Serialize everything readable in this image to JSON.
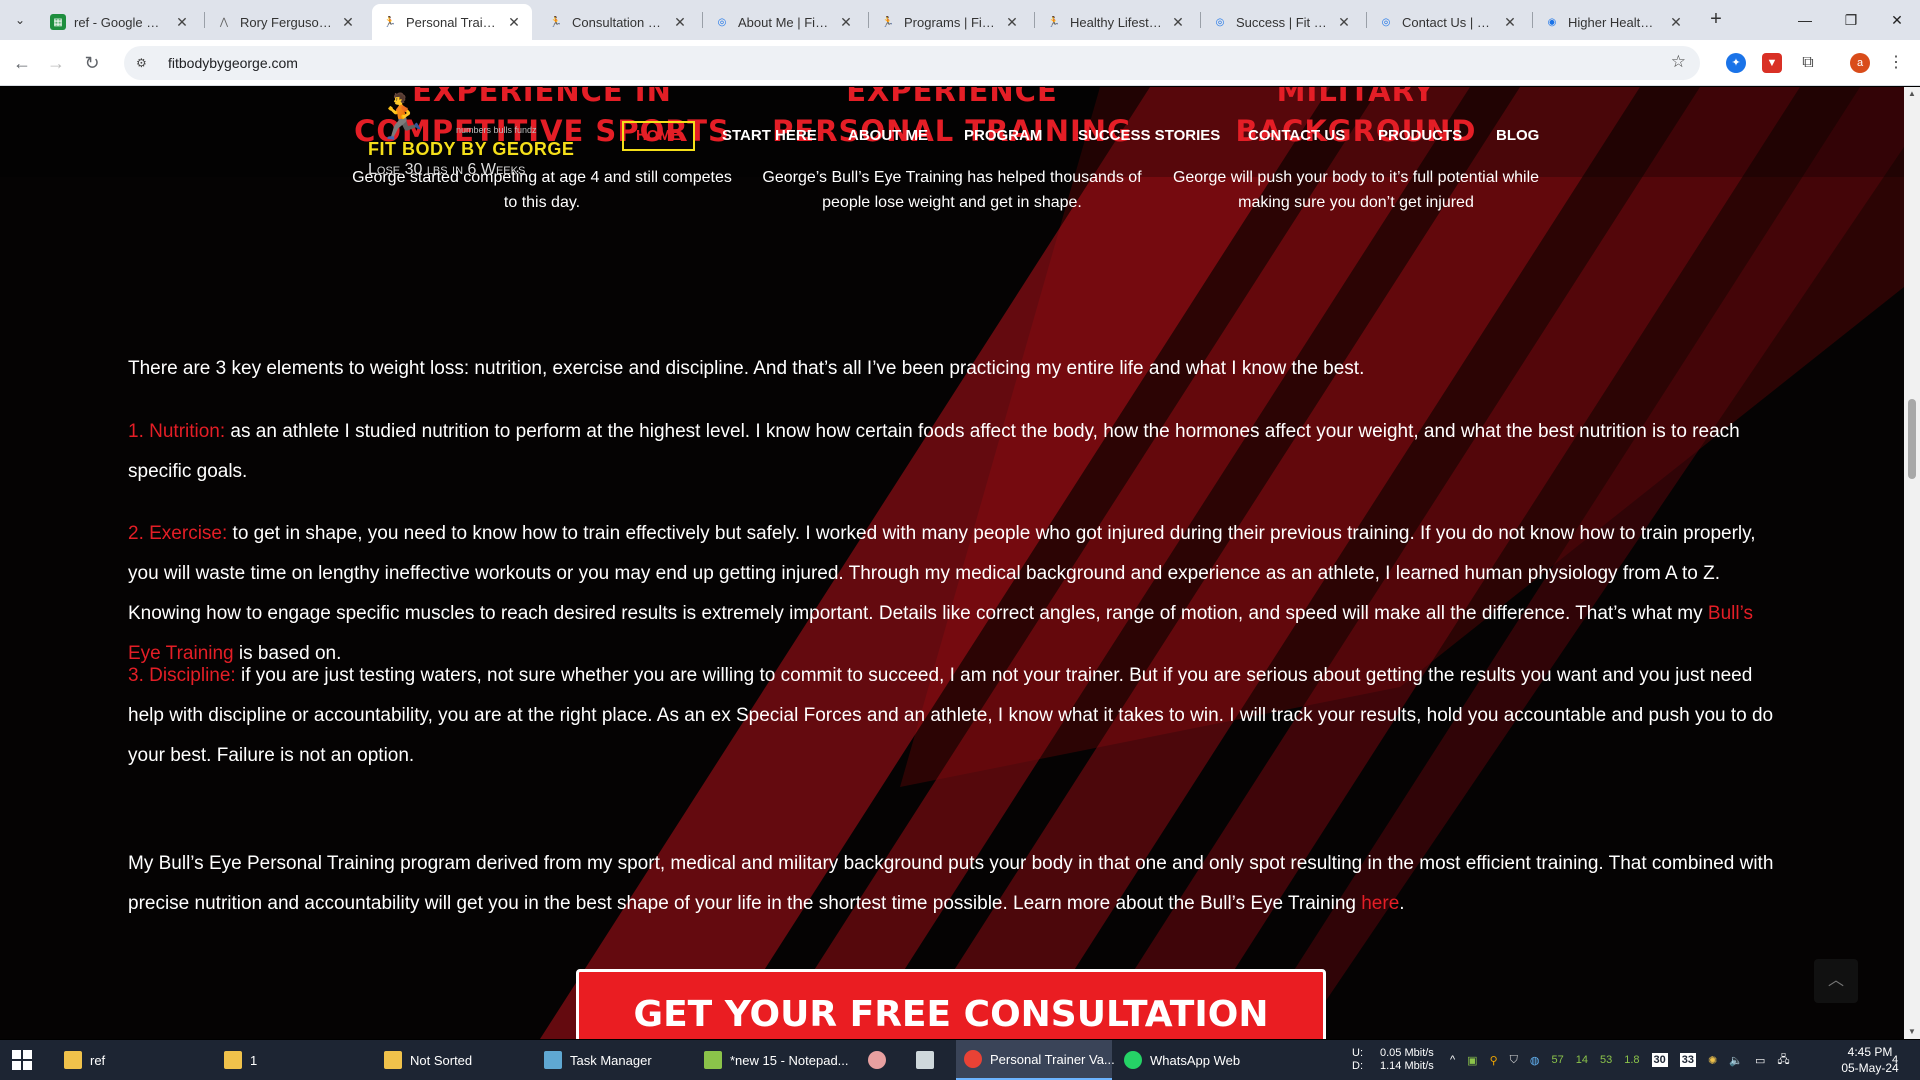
{
  "browser": {
    "tabs": [
      {
        "title": "ref - Google Sheets",
        "icon": "sheets-icon",
        "color": "#1e8e3e"
      },
      {
        "title": "Rory Ferguson - Personal",
        "icon": "site-icon",
        "color": "#666666"
      },
      {
        "title": "Personal Trainer Vancouver",
        "icon": "runner-icon",
        "color": "#333333",
        "active": true
      },
      {
        "title": "Consultation Form",
        "icon": "runner-icon",
        "color": "#333333"
      },
      {
        "title": "About Me | Fit Body",
        "icon": "target-icon",
        "color": "#1a73e8"
      },
      {
        "title": "Programs | Fit Body",
        "icon": "runner-icon",
        "color": "#333333"
      },
      {
        "title": "Healthy Lifestyle Blog",
        "icon": "runner-icon",
        "color": "#333333"
      },
      {
        "title": "Success | Fit Body",
        "icon": "target-icon",
        "color": "#1a73e8"
      },
      {
        "title": "Contact Us | Fit Body",
        "icon": "target-icon",
        "color": "#1a73e8"
      },
      {
        "title": "Higher Healths Care",
        "icon": "globe-icon",
        "color": "#1a73e8"
      }
    ],
    "url": "fitbodybygeorge.com",
    "profile_initial": "a"
  },
  "site": {
    "logo": {
      "brand": "FIT BODY BY GEORGE",
      "tagline": "Lose 30 lbs in 6 Weeks",
      "mini_text": "numbers bulls fundz"
    },
    "nav": [
      "HOME",
      "START HERE",
      "ABOUT ME",
      "PROGRAM",
      "SUCCESS STORIES",
      "CONTACT US",
      "PRODUCTS",
      "BLOG"
    ],
    "features": [
      {
        "title_line1": "EXPERIENCE IN",
        "title_line2": "COMPETITIVE SPORTS",
        "text": "George started competing at age 4 and still competes to this day."
      },
      {
        "title_line1": "EXPERIENCE",
        "title_line2": "PERSONAL TRAINING",
        "text": "George’s Bull’s Eye Training has helped thousands of people lose weight and get in shape."
      },
      {
        "title_line1": "MILITARY",
        "title_line2": "BACKGROUND",
        "text": "George will push your body to it’s full potential while making sure you don’t get injured"
      }
    ],
    "intro": "There are 3 key elements to weight loss: nutrition, exercise and discipline. And that’s all I’ve been practicing my entire life and what I know the best.",
    "nutrition": {
      "label": "1. Nutrition:",
      "text": " as an athlete I studied nutrition to perform at the highest level. I know how certain foods affect the body, how the hormones affect your weight, and what the best nutrition is to reach specific goals."
    },
    "exercise": {
      "label": "2. Exercise:",
      "text": " to get in shape, you need to know how to train effectively but safely. I worked with many people who got injured during their previous training. If you do not know how to train properly, you will waste time on lengthy ineffective workouts or you may end up getting injured. Through my medical background and experience as an athlete, I learned human physiology from A to Z. Knowing how to engage specific muscles to reach desired results is extremely important. Details like correct angles, range of motion, and speed will make all the difference. That’s what my ",
      "link": "Bull’s Eye Training",
      "after": " is based on."
    },
    "discipline": {
      "label": "3. Discipline:",
      "text": " if you are just testing waters, not sure whether you are willing to commit to succeed, I am not your trainer. But if you are serious about getting the results you want and you just need help with discipline or accountability, you are at the right place. As an ex Special Forces and an athlete, I know what it takes to win. I will track your results, hold you accountable and push you to do your best. Failure is not an option."
    },
    "program": {
      "text": "My Bull’s Eye Personal Training program derived from my sport, medical and military background puts your body in that one and only spot resulting in the most efficient training. That combined with precise nutrition and accountability will get you in the best shape of your life in the shortest time possible. Learn more about the Bull’s Eye Training ",
      "link": "here",
      "after": "."
    },
    "cta": "GET YOUR FREE CONSULTATION NOW",
    "accent_color": "#e41e26",
    "highlight_color": "#f5df1a"
  },
  "taskbar": {
    "items": [
      {
        "label": "ref",
        "icon": "folder-icon",
        "color": "#f0c24b"
      },
      {
        "label": "1",
        "icon": "folder-icon",
        "color": "#f0c24b"
      },
      {
        "label": "Not Sorted",
        "icon": "folder-icon",
        "color": "#f0c24b"
      },
      {
        "label": "Task Manager",
        "icon": "task-manager-icon",
        "color": "#5fa8d3"
      },
      {
        "label": "*new 15 - Notepad...",
        "icon": "notepad-plus-icon",
        "color": "#8bc34a"
      },
      {
        "label": "",
        "icon": "app-icon",
        "color": "#e8a0a0"
      },
      {
        "label": "",
        "icon": "document-icon",
        "color": "#cfd8dc"
      },
      {
        "label": "Personal Trainer Va...",
        "icon": "chrome-icon",
        "color": "#e94235",
        "active": true
      },
      {
        "label": "WhatsApp Web",
        "icon": "whatsapp-icon",
        "color": "#25d366"
      }
    ],
    "net_up_label": "U:",
    "net_down_label": "D:",
    "net_up": "0.05 Mbit/s",
    "net_down": "1.14 Mbit/s",
    "tray_numbers": [
      "57",
      "14",
      "53",
      "1.8"
    ],
    "badge_numbers": [
      "30",
      "33"
    ],
    "time": "4:45 PM",
    "date": "05-May-24",
    "notifications": "4"
  }
}
